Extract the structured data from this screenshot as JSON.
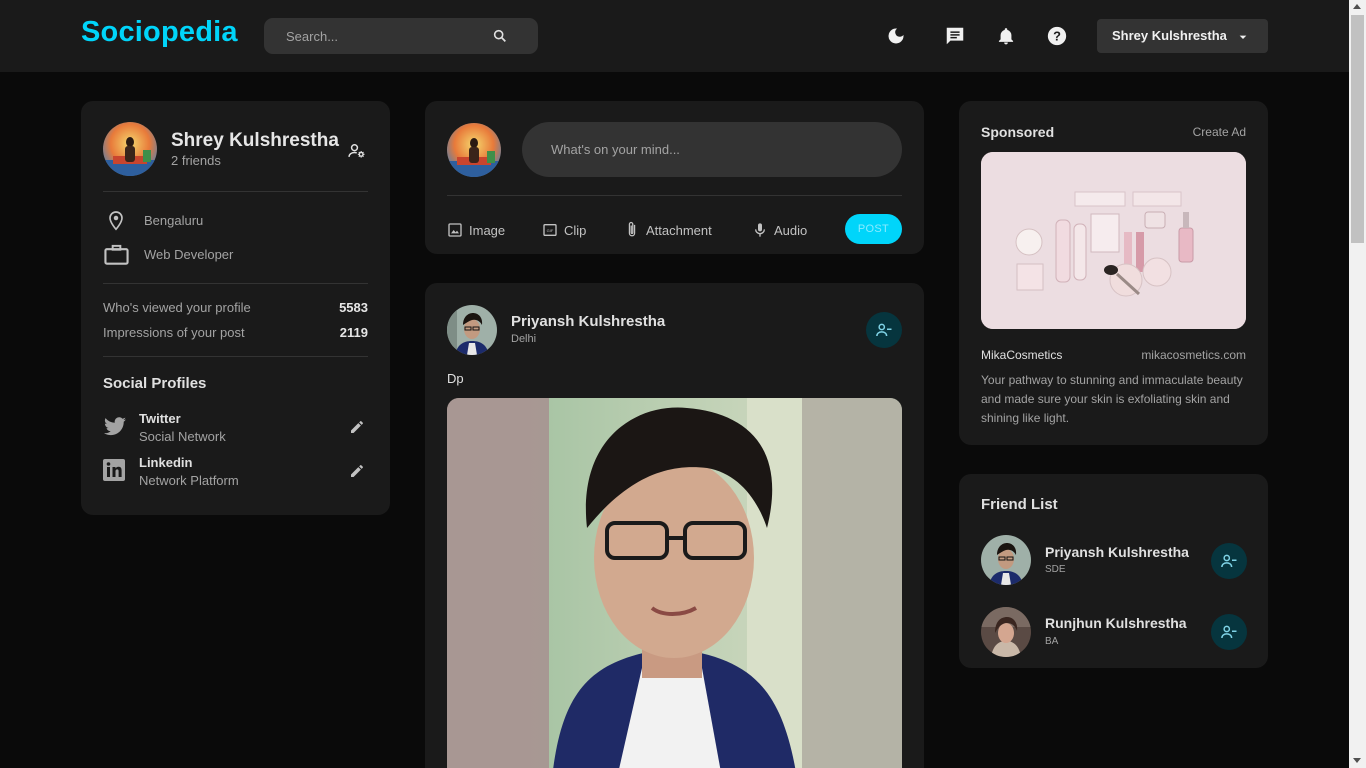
{
  "navbar": {
    "logo": "Sociopedia",
    "search_placeholder": "Search...",
    "user_name": "Shrey Kulshrestha"
  },
  "profile": {
    "name": "Shrey Kulshrestha",
    "friends": "2 friends",
    "location": "Bengaluru",
    "occupation": "Web Developer",
    "stats": [
      {
        "label": "Who's viewed your profile",
        "value": "5583"
      },
      {
        "label": "Impressions of your post",
        "value": "2119"
      }
    ],
    "social_title": "Social Profiles",
    "socials": [
      {
        "name": "Twitter",
        "sub": "Social Network"
      },
      {
        "name": "Linkedin",
        "sub": "Network Platform"
      }
    ]
  },
  "composer": {
    "placeholder": "What's on your mind...",
    "tools": [
      "Image",
      "Clip",
      "Attachment",
      "Audio"
    ],
    "post_label": "POST"
  },
  "feed_post": {
    "author": "Priyansh Kulshrestha",
    "location": "Delhi",
    "description": "Dp"
  },
  "sponsored": {
    "title": "Sponsored",
    "create": "Create Ad",
    "brand": "MikaCosmetics",
    "site": "mikacosmetics.com",
    "description": "Your pathway to stunning and immaculate beauty and made sure your skin is exfoliating skin and shining like light."
  },
  "friend_list": {
    "title": "Friend List",
    "friends": [
      {
        "name": "Priyansh Kulshrestha",
        "sub": "SDE"
      },
      {
        "name": "Runjhun Kulshrestha",
        "sub": "BA"
      }
    ]
  },
  "colors": {
    "primary": "#00d5fa",
    "background": "#0a0a0a",
    "card": "#1a1a1a",
    "input": "#333333"
  },
  "icons": [
    "search-icon",
    "dark-mode-icon",
    "message-icon",
    "notification-icon",
    "help-icon",
    "caret-down-icon",
    "manage-accounts-icon",
    "location-icon",
    "work-icon",
    "twitter-icon",
    "linkedin-icon",
    "edit-icon",
    "image-icon",
    "gif-icon",
    "attachment-icon",
    "mic-icon",
    "person-remove-icon"
  ]
}
